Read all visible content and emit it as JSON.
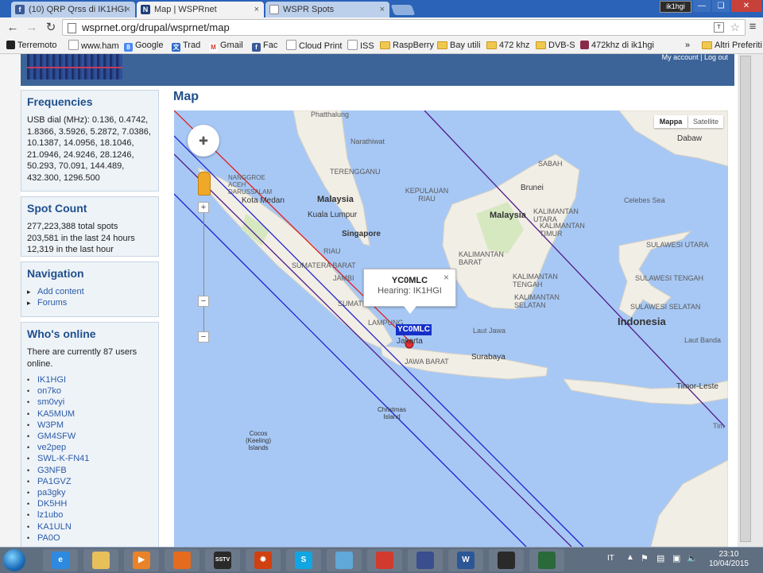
{
  "browser": {
    "tabs": [
      {
        "title": "(10) QRP Qrss di IK1HGI",
        "favicon": "facebook-icon",
        "favicon_letter": "f",
        "color": "#3b5998"
      },
      {
        "title": "Map | WSPRnet",
        "favicon": "wsprnet-icon",
        "favicon_letter": "N",
        "color": "#1f3f7a"
      },
      {
        "title": "WSPR Spots",
        "favicon": "page-icon",
        "favicon_letter": "",
        "color": "#ffffff"
      }
    ],
    "close_glyph": "×",
    "user_badge": "ik1hgi",
    "url": "wsprnet.org/drupal/wsprnet/map",
    "bookmarks": [
      {
        "label": "Terremoto",
        "icon": "page-icon"
      },
      {
        "label": "www.ham",
        "icon": "page-icon"
      },
      {
        "label": "Google",
        "icon": "google-icon"
      },
      {
        "label": "Trad",
        "icon": "translate-icon"
      },
      {
        "label": "Gmail",
        "icon": "gmail-icon"
      },
      {
        "label": "Fac",
        "icon": "facebook-icon"
      },
      {
        "label": "Cloud Print",
        "icon": "printer-icon"
      },
      {
        "label": "ISS",
        "icon": "page-icon"
      },
      {
        "label": "RaspBerry",
        "icon": "folder-icon"
      },
      {
        "label": "Bay utili",
        "icon": "folder-icon"
      },
      {
        "label": "472 khz",
        "icon": "folder-icon"
      },
      {
        "label": "DVB-S",
        "icon": "folder-icon"
      },
      {
        "label": "472khz di ik1hgi",
        "icon": "grid-icon"
      }
    ],
    "bookmarks_more": "»",
    "bookmarks_other": "Altri Preferiti"
  },
  "site": {
    "header_links": [
      "My account",
      "Log out"
    ]
  },
  "sidebar": {
    "frequencies": {
      "title": "Frequencies",
      "text": "USB dial (MHz): 0.136, 0.4742, 1.8366, 3.5926, 5.2872, 7.0386, 10.1387, 14.0956, 18.1046, 21.0946, 24.9246, 28.1246, 50.293, 70.091, 144.489, 432.300, 1296.500"
    },
    "spot_count": {
      "title": "Spot Count",
      "lines": [
        "277,223,388 total spots",
        "203,581 in the last 24 hours",
        "12,319 in the last hour"
      ]
    },
    "navigation": {
      "title": "Navigation",
      "items": [
        "Add content",
        "Forums"
      ]
    },
    "whos_online": {
      "title": "Who's online",
      "text": "There are currently 87 users online.",
      "users": [
        "IK1HGI",
        "on7ko",
        "sm0vyi",
        "KA5MUM",
        "W3PM",
        "GM4SFW",
        "ve2pep",
        "SWL-K-FN41",
        "G3NFB",
        "PA1GVZ",
        "pa3gky",
        "DK5HH",
        "lz1ubo",
        "KA1ULN",
        "PA0O"
      ]
    }
  },
  "map": {
    "title": "Map",
    "type_buttons": [
      "Mappa",
      "Satellite"
    ],
    "zoom_in": "+",
    "zoom_out": "−",
    "zoom_mark": "−",
    "infowindow": {
      "callsign": "YC0MLC",
      "hearing": "Hearing: IK1HGI",
      "close": "×"
    },
    "station_label": "YC0MLC",
    "labels": {
      "countries": [
        "Malaysia",
        "Malaysia",
        "Indonesia"
      ],
      "cities": [
        "Kota Medan",
        "Kuala Lumpur",
        "Singapore",
        "Jakarta",
        "Surabaya",
        "Brunei",
        "Dabaw",
        "Timor-Leste",
        "Christmas Island",
        "Cocos (Keeling) Islands"
      ],
      "regions": [
        "Phatthalung",
        "Narathiwat",
        "TERENGGANU",
        "NANGGROE ACEH DARUSSALAM",
        "KEPULAUAN RIAU",
        "SABAH",
        "KALIMANTAN UTARA",
        "KALIMANTAN TIMUR",
        "KALIMANTAN BARAT",
        "KALIMANTAN TENGAH",
        "KALIMANTAN SELATAN",
        "SUMATERA BARAT",
        "JAMBI",
        "SUMATERA SELATAN",
        "LAMPUNG",
        "JAWA BARAT",
        "RIAU",
        "Laut Jawa",
        "Celebes Sea",
        "SULAWESI UTARA",
        "SULAWESI TENGAH",
        "SULAWESI SELATAN",
        "Laut Banda",
        "Tim"
      ]
    }
  },
  "taskbar": {
    "apps": [
      {
        "name": "internet-explorer-icon",
        "glyph": "e",
        "color": "#2d8ae0"
      },
      {
        "name": "file-explorer-icon",
        "glyph": "",
        "color": "#e7c05a"
      },
      {
        "name": "media-player-icon",
        "glyph": "▶",
        "color": "#e8832a"
      },
      {
        "name": "firefox-icon",
        "glyph": "",
        "color": "#e56b1f"
      },
      {
        "name": "sstv-icon",
        "glyph": "SSTV",
        "color": "#2a2a2a"
      },
      {
        "name": "spark-icon",
        "glyph": "✸",
        "color": "#d04010"
      },
      {
        "name": "skype-icon",
        "glyph": "S",
        "color": "#12a5e3"
      },
      {
        "name": "notes-icon",
        "glyph": "",
        "color": "#5fa8d8"
      },
      {
        "name": "chrome-icon",
        "glyph": "",
        "color": "#d23a2e"
      },
      {
        "name": "save-icon",
        "glyph": "",
        "color": "#3a4d8f"
      },
      {
        "name": "word-icon",
        "glyph": "W",
        "color": "#2b5797"
      },
      {
        "name": "compass-icon",
        "glyph": "",
        "color": "#2a2a2a"
      },
      {
        "name": "globe-icon",
        "glyph": "",
        "color": "#2a6a3a"
      }
    ],
    "language": "IT",
    "time": "23:10",
    "date": "10/04/2015"
  },
  "colors": {
    "sea": "#a7c8f5",
    "land": "#f1eee6",
    "forest": "#d6e8c0",
    "path_red": "#e02020",
    "path_blue": "#1f1fd0",
    "path_purple": "#501a8a"
  }
}
